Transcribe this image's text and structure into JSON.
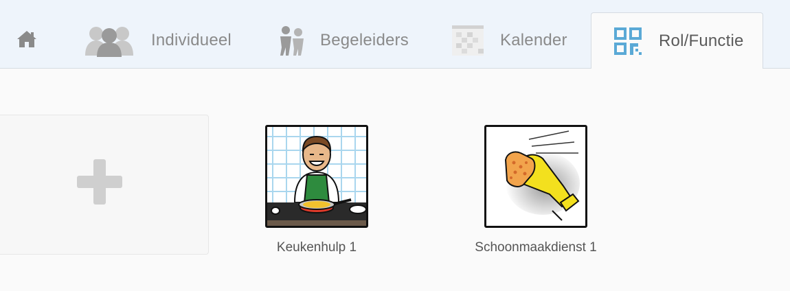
{
  "nav": {
    "home_icon": "home-icon",
    "tabs": [
      {
        "id": "individueel",
        "label": "Individueel",
        "icon": "people-group-icon",
        "active": false
      },
      {
        "id": "begeleiders",
        "label": "Begeleiders",
        "icon": "caregivers-icon",
        "active": false
      },
      {
        "id": "kalender",
        "label": "Kalender",
        "icon": "calendar-grid-icon",
        "active": false
      },
      {
        "id": "rol-functie",
        "label": "Rol/Functie",
        "icon": "qr-grid-icon",
        "active": true
      }
    ],
    "accent_color": "#5aa9d6"
  },
  "content": {
    "add_icon": "plus-icon",
    "roles": [
      {
        "name": "Keukenhulp 1",
        "icon": "kitchen-helper-icon"
      },
      {
        "name": "Schoonmaakdienst 1",
        "icon": "cleaning-glove-icon"
      }
    ]
  }
}
